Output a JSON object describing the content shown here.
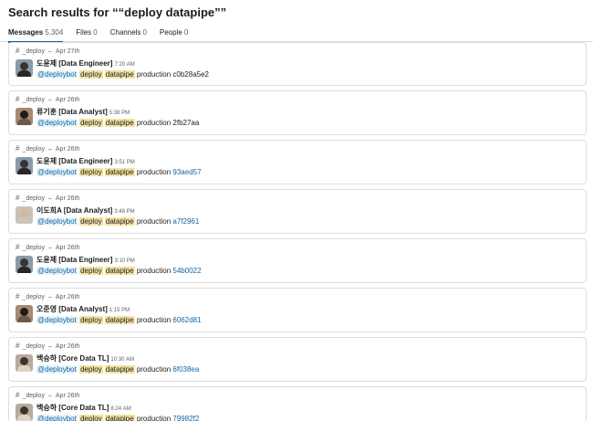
{
  "header": {
    "title": "Search results for ““deploy datapipe””"
  },
  "tabs": [
    {
      "label": "Messages",
      "count": "5,304",
      "active": true
    },
    {
      "label": "Files",
      "count": "0",
      "active": false
    },
    {
      "label": "Channels",
      "count": "0",
      "active": false
    },
    {
      "label": "People",
      "count": "0",
      "active": false
    }
  ],
  "results": [
    {
      "channel": "_deploy",
      "date": "Apr 27th",
      "author": "도윤제 [Data Engineer]",
      "time": "7:20 AM",
      "mention": "@deploybot",
      "hl1": "deploy",
      "hl2": "datapipe",
      "word": "production",
      "hash": "c0b28a5e2",
      "hash_link": false,
      "avatar": "av-a"
    },
    {
      "channel": "_deploy",
      "date": "Apr 26th",
      "author": "류기훈 [Data Analyst]",
      "time": "5:38 PM",
      "mention": "@deploybot",
      "hl1": "deploy",
      "hl2": "datapipe",
      "word": "production",
      "hash": "2fb27aa",
      "hash_link": false,
      "avatar": "av-b"
    },
    {
      "channel": "_deploy",
      "date": "Apr 26th",
      "author": "도윤제 [Data Engineer]",
      "time": "3:51 PM",
      "mention": "@deploybot",
      "hl1": "deploy",
      "hl2": "datapipe",
      "word": "production",
      "hash": "93aed57",
      "hash_link": true,
      "avatar": "av-a"
    },
    {
      "channel": "_deploy",
      "date": "Apr 26th",
      "author": "이도희A [Data Analyst]",
      "time": "3:48 PM",
      "mention": "@deploybot",
      "hl1": "deploy",
      "hl2": "datapipe",
      "word": "production",
      "hash": "a7f2961",
      "hash_link": true,
      "avatar": "av-c"
    },
    {
      "channel": "_deploy",
      "date": "Apr 26th",
      "author": "도윤제 [Data Engineer]",
      "time": "3:10 PM",
      "mention": "@deploybot",
      "hl1": "deploy",
      "hl2": "datapipe",
      "word": "production",
      "hash": "54b0022",
      "hash_link": true,
      "avatar": "av-a"
    },
    {
      "channel": "_deploy",
      "date": "Apr 26th",
      "author": "오준영 [Data Analyst]",
      "time": "1:15 PM",
      "mention": "@deploybot",
      "hl1": "deploy",
      "hl2": "datapipe",
      "word": "production",
      "hash": "6062d81",
      "hash_link": true,
      "avatar": "av-b"
    },
    {
      "channel": "_deploy",
      "date": "Apr 26th",
      "author": "백승하 [Core Data TL]",
      "time": "10:30 AM",
      "mention": "@deploybot",
      "hl1": "deploy",
      "hl2": "datapipe",
      "word": "production",
      "hash": "6f038ea",
      "hash_link": true,
      "avatar": "av-d"
    },
    {
      "channel": "_deploy",
      "date": "Apr 26th",
      "author": "백승하 [Core Data TL]",
      "time": "8:24 AM",
      "mention": "@deploybot",
      "hl1": "deploy",
      "hl2": "datapipe",
      "word": "production",
      "hash": "79982f2",
      "hash_link": true,
      "avatar": "av-d"
    }
  ]
}
